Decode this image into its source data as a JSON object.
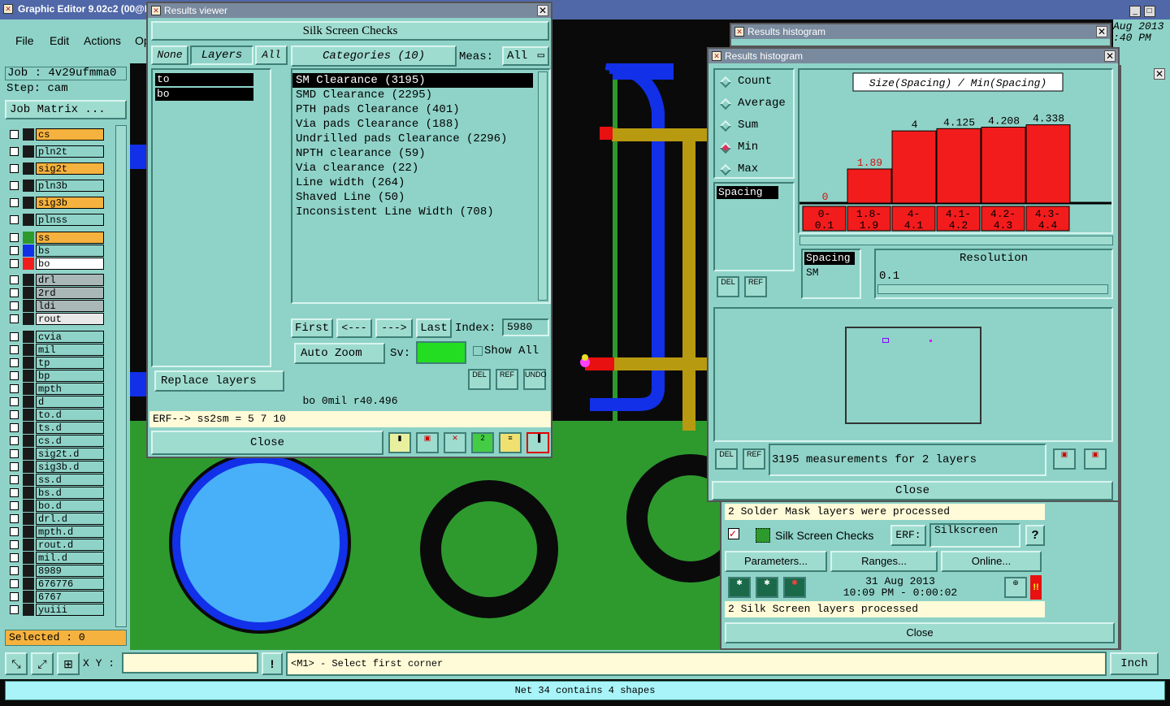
{
  "main_window": {
    "title": "Graphic Editor 9.02c2 (00@H",
    "menu": [
      "File",
      "Edit",
      "Actions",
      "Op"
    ],
    "job_label": "Job : 4v29ufmma0",
    "step_label": "Step: cam",
    "job_matrix": "Job Matrix ...",
    "selected": "Selected : 0",
    "xy_label": "X Y :",
    "xy_value": "",
    "prompt": "<M1> - Select first corner",
    "units": "Inch",
    "status": "Net 34 contains 4 shapes",
    "bg_window_time": "Aug 2013\n:40 PM"
  },
  "layers": [
    {
      "name": "cs",
      "color": "#f6b23e",
      "swatch": "#1a1a1a"
    },
    {
      "name": "pln2t",
      "color": "#8fd3c8",
      "swatch": "#1a1a1a"
    },
    {
      "name": "sig2t",
      "color": "#f6b23e",
      "swatch": "#1a1a1a"
    },
    {
      "name": "pln3b",
      "color": "#8fd3c8",
      "swatch": "#1a1a1a"
    },
    {
      "name": "sig3b",
      "color": "#f6b23e",
      "swatch": "#1a1a1a"
    },
    {
      "name": "plnss",
      "color": "#8fd3c8",
      "swatch": "#1a1a1a"
    },
    {
      "name": "ss",
      "color": "#f6b23e",
      "swatch": "#2e9a2e"
    },
    {
      "name": "bs",
      "color": "#8fd3c8",
      "swatch": "#1230e8"
    },
    {
      "name": "bo",
      "color": "#ffffff",
      "swatch": "#f21c1c"
    },
    {
      "name": "drl",
      "color": "#a9b7b7",
      "swatch": "#1a1a1a"
    },
    {
      "name": "2rd",
      "color": "#a9b7b7",
      "swatch": "#1a1a1a"
    },
    {
      "name": "ldi",
      "color": "#a9b7b7",
      "swatch": "#1a1a1a"
    },
    {
      "name": "rout",
      "color": "#e8e8e8",
      "swatch": "#1a1a1a"
    },
    {
      "name": "cvia",
      "color": "#8fd3c8",
      "swatch": "#1a1a1a"
    },
    {
      "name": "mil",
      "color": "#8fd3c8",
      "swatch": "#1a1a1a"
    },
    {
      "name": "tp",
      "color": "#8fd3c8",
      "swatch": "#1a1a1a"
    },
    {
      "name": "bp",
      "color": "#8fd3c8",
      "swatch": "#1a1a1a"
    },
    {
      "name": "mpth",
      "color": "#8fd3c8",
      "swatch": "#1a1a1a"
    },
    {
      "name": "d",
      "color": "#8fd3c8",
      "swatch": "#1a1a1a"
    },
    {
      "name": "to.d",
      "color": "#8fd3c8",
      "swatch": "#1a1a1a"
    },
    {
      "name": "ts.d",
      "color": "#8fd3c8",
      "swatch": "#1a1a1a"
    },
    {
      "name": "cs.d",
      "color": "#8fd3c8",
      "swatch": "#1a1a1a"
    },
    {
      "name": "sig2t.d",
      "color": "#8fd3c8",
      "swatch": "#1a1a1a"
    },
    {
      "name": "sig3b.d",
      "color": "#8fd3c8",
      "swatch": "#1a1a1a"
    },
    {
      "name": "ss.d",
      "color": "#8fd3c8",
      "swatch": "#1a1a1a"
    },
    {
      "name": "bs.d",
      "color": "#8fd3c8",
      "swatch": "#1a1a1a"
    },
    {
      "name": "bo.d",
      "color": "#8fd3c8",
      "swatch": "#1a1a1a"
    },
    {
      "name": "drl.d",
      "color": "#8fd3c8",
      "swatch": "#1a1a1a"
    },
    {
      "name": "mpth.d",
      "color": "#8fd3c8",
      "swatch": "#1a1a1a"
    },
    {
      "name": "rout.d",
      "color": "#8fd3c8",
      "swatch": "#1a1a1a"
    },
    {
      "name": "mil.d",
      "color": "#8fd3c8",
      "swatch": "#1a1a1a"
    },
    {
      "name": "8989",
      "color": "#8fd3c8",
      "swatch": "#1a1a1a"
    },
    {
      "name": "676776",
      "color": "#8fd3c8",
      "swatch": "#1a1a1a"
    },
    {
      "name": "6767",
      "color": "#8fd3c8",
      "swatch": "#1a1a1a"
    },
    {
      "name": "yuiii",
      "color": "#8fd3c8",
      "swatch": "#1a1a1a"
    }
  ],
  "results_viewer": {
    "title": "Results viewer",
    "header": "Silk Screen Checks",
    "tabs": [
      "None",
      "Layers",
      "All"
    ],
    "layers": [
      "to",
      "bo"
    ],
    "categories_label": "Categories (10)",
    "meas_label": "Meas:",
    "meas_value": "All",
    "categories": [
      "SM Clearance (3195)",
      "SMD Clearance (2295)",
      "PTH pads Clearance (401)",
      "Via pads Clearance (188)",
      "Undrilled pads Clearance (2296)",
      "NPTH clearance (59)",
      "Via clearance (22)",
      "Line width (264)",
      "Shaved Line (50)",
      "Inconsistent Line Width (708)"
    ],
    "nav": [
      "First",
      "<---",
      "--->",
      "Last"
    ],
    "index_label": "Index:",
    "index_value": "5980",
    "auto_zoom": "Auto Zoom",
    "sv_label": "Sv:",
    "show_all": "Show All",
    "replace_layers": "Replace layers",
    "del": "DEL",
    "ref": "REF",
    "undo": "UNDO",
    "info": "bo 0mil   r40.496",
    "erf": "ERF--> ss2sm = 5 7 10",
    "close": "Close"
  },
  "histogram": {
    "title": "Results histogram",
    "bg_title": "Results histogram",
    "options": [
      "Count",
      "Average",
      "Sum",
      "Min",
      "Max"
    ],
    "selected_option": "Min",
    "chart_title": "Size(Spacing) / Min(Spacing)",
    "spacing_item": "Spacing",
    "spacing_list": [
      "Spacing",
      "SM"
    ],
    "resolution_label": "Resolution",
    "resolution_value": "0.1",
    "summary": "3195 measurements for 2 layers",
    "close": "Close",
    "del": "DEL",
    "ref": "REF"
  },
  "chart_data": {
    "type": "bar",
    "title": "Size(Spacing) / Min(Spacing)",
    "categories": [
      "0-\n0.1",
      "1.8-\n1.9",
      "4-\n4.1",
      "4.1-\n4.2",
      "4.2-\n4.3",
      "4.3-\n4.4"
    ],
    "values": [
      0,
      1.89,
      4,
      4.125,
      4.208,
      4.338
    ],
    "value_labels": [
      "0",
      "1.89",
      "4",
      "4.125",
      "4.208",
      "4.338"
    ],
    "ylim": [
      0,
      4.5
    ],
    "bar_color": "#f21c1c",
    "highlight_label_color": "#d21010"
  },
  "checklist": {
    "msg1": "2 Solder Mask layers were processed",
    "check_name": "Silk Screen Checks",
    "erf_label": "ERF:",
    "erf_value": "Silkscreen",
    "help": "?",
    "buttons": [
      "Parameters...",
      "Ranges...",
      "Online..."
    ],
    "date": "31 Aug 2013",
    "time": "10:09 PM - 0:00:02",
    "msg2": "2 Silk Screen layers processed",
    "close": "Close"
  }
}
